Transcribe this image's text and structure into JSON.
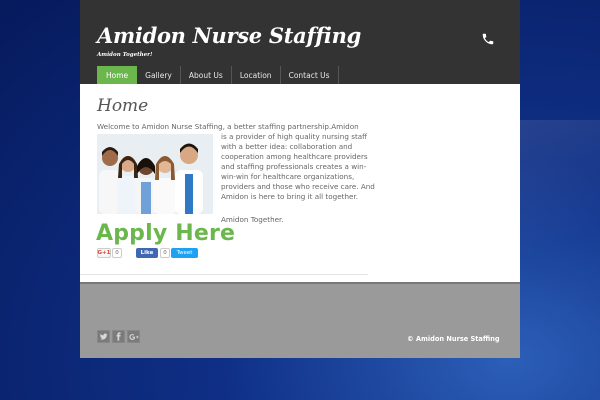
{
  "site": {
    "title": "Amidon Nurse Staffing",
    "tagline": "Amidon Together!"
  },
  "nav": {
    "items": [
      {
        "label": "Home",
        "active": true
      },
      {
        "label": "Gallery",
        "active": false
      },
      {
        "label": "About Us",
        "active": false
      },
      {
        "label": "Location",
        "active": false
      },
      {
        "label": "Contact Us",
        "active": false
      }
    ]
  },
  "main": {
    "heading": "Home",
    "welcome": "Welcome to Amidon Nurse Staffing, a better staffing partnership.Amidon",
    "body": "is a provider of high quality nursing staff with a better idea: collaboration and cooperation among healthcare providers and staffing professionals creates a win-win-win for healthcare organizations, providers and those who receive care. And Amidon is here to bring it all together.",
    "closing": "Amidon Together.",
    "cta": "Apply Here"
  },
  "social_share": {
    "gplus_label": "G+1",
    "gplus_count": "0",
    "fb_label": "Like",
    "fb_count": "0",
    "tweet_label": "Tweet"
  },
  "footer": {
    "copyright": "© Amidon Nurse Staffing"
  },
  "colors": {
    "accent": "#6cb74d",
    "header": "#333333",
    "footer": "#9a9a9a",
    "background": "#0f2f86"
  },
  "icons": [
    "phone-icon",
    "twitter-icon",
    "facebook-icon",
    "google-plus-icon"
  ]
}
